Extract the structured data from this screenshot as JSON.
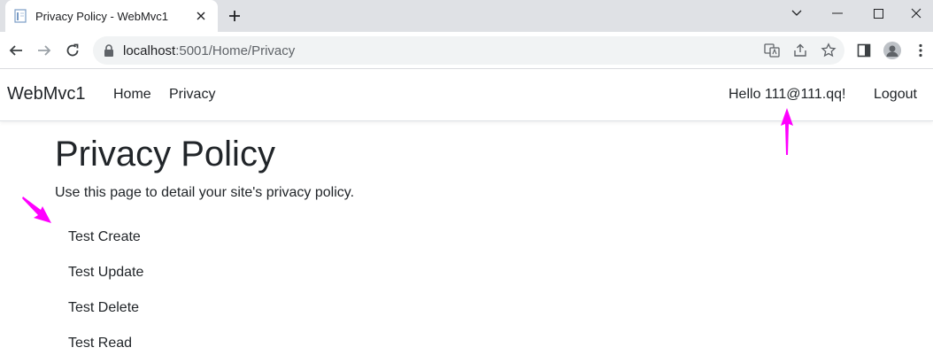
{
  "browser": {
    "tab_title": "Privacy Policy - WebMvc1",
    "url_host": "localhost",
    "url_rest": ":5001/Home/Privacy"
  },
  "site": {
    "brand": "WebMvc1",
    "nav": [
      {
        "label": "Home"
      },
      {
        "label": "Privacy"
      }
    ],
    "greeting": "Hello 111@111.qq!",
    "logout": "Logout"
  },
  "main": {
    "title": "Privacy Policy",
    "description": "Use this page to detail your site's privacy policy.",
    "links": [
      {
        "label": "Test Create"
      },
      {
        "label": "Test Update"
      },
      {
        "label": "Test Delete"
      },
      {
        "label": "Test Read"
      }
    ]
  },
  "annotations": {
    "arrow_color": "#ff00ff"
  }
}
